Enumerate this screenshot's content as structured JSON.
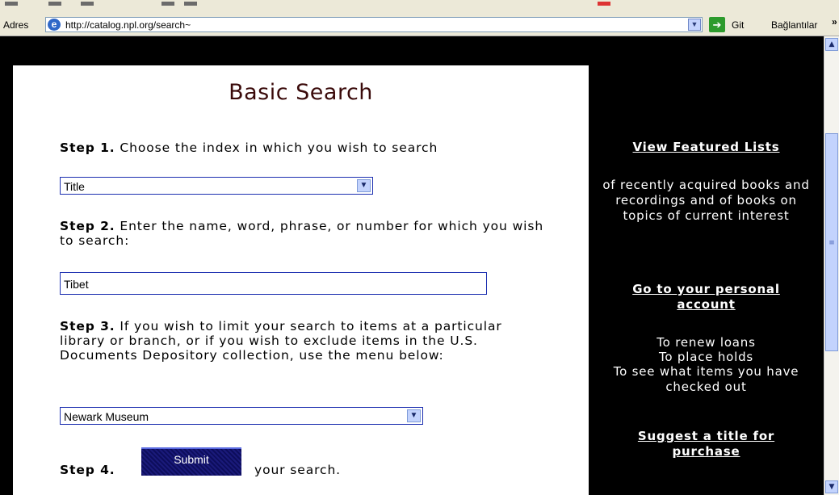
{
  "browser": {
    "address_label": "Adres",
    "url": "http://catalog.npl.org/search~",
    "go_label": "Git",
    "links_label": "Bağlantılar",
    "links_chevron": "»"
  },
  "main": {
    "title": "Basic Search",
    "step1_label": "Step 1.",
    "step1_text": " Choose the index in which you wish to search",
    "index_select_value": "Title",
    "step2_label": "Step 2.",
    "step2_text": " Enter the name, word, phrase, or number for which you wish to search:",
    "search_value": "Tibet",
    "step3_label": "Step 3.",
    "step3_text": " If you wish to limit your search to items at a particular library or branch, or if you wish to exclude items in the U.S. Documents Depository collection, use the menu below:",
    "location_select_value": "Newark Museum",
    "step4_label": "Step 4.",
    "submit_label": "Submit",
    "step4_suffix": "your search."
  },
  "sidebar": {
    "featured_link": "View Featured Lists",
    "featured_desc": "of recently acquired books and recordings and of books on topics of current interest",
    "account_link": "Go to your personal account",
    "account_line1": "To renew loans",
    "account_line2": "To place holds",
    "account_line3": "To see what items you have checked out",
    "suggest_link": "Suggest a title for purchase"
  },
  "colors": {
    "page_background": "#000000",
    "panel_background": "#ffffff",
    "title_color": "#3a0a0a",
    "input_border": "#1c2fb0",
    "submit_background": "#0d0d5c"
  }
}
